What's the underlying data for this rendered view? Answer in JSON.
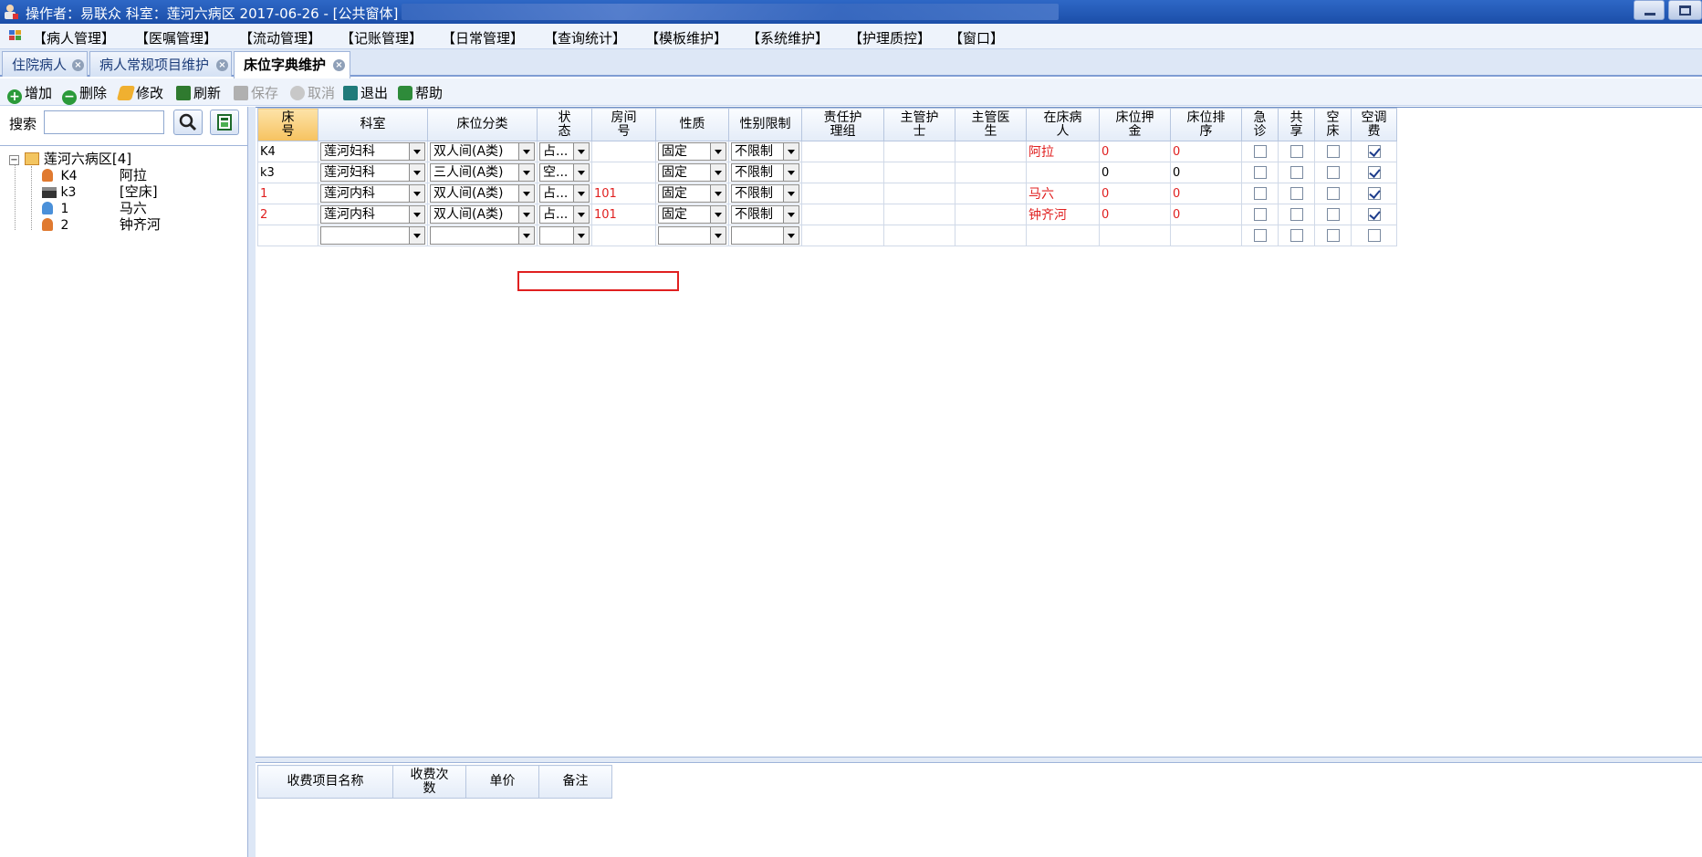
{
  "window": {
    "title": "操作者：易联众  科室：莲河六病区  2017-06-26 - [公共窗体]"
  },
  "menu": [
    "【病人管理】",
    "【医嘱管理】",
    "【流动管理】",
    "【记账管理】",
    "【日常管理】",
    "【查询统计】",
    "【模板维护】",
    "【系统维护】",
    "【护理质控】",
    "【窗口】"
  ],
  "tabs": [
    {
      "label": "住院病人"
    },
    {
      "label": "病人常规项目维护"
    },
    {
      "label": "床位字典维护"
    }
  ],
  "toolbar": {
    "add": "增加",
    "delete": "删除",
    "modify": "修改",
    "refresh": "刷新",
    "save": "保存",
    "cancel": "取消",
    "exit": "退出",
    "help": "帮助"
  },
  "search": {
    "label": "搜索",
    "value": ""
  },
  "tree": {
    "root": "莲河六病区[4]",
    "items": [
      {
        "bed": "K4",
        "patient": "阿拉"
      },
      {
        "bed": "k3",
        "patient": "[空床]"
      },
      {
        "bed": "1",
        "patient": "马六"
      },
      {
        "bed": "2",
        "patient": "钟齐河"
      }
    ]
  },
  "grid": {
    "headers": {
      "bed_no": "床\n号",
      "dept": "科室",
      "category": "床位分类",
      "status": "状\n态",
      "room": "房间\n号",
      "nature": "性质",
      "gender": "性别限制",
      "nurse_group": "责任护\n理组",
      "nurse": "主管护\n士",
      "doctor": "主管医\n生",
      "patient": "在床病\n人",
      "deposit": "床位押\n金",
      "order": "床位排\n序",
      "emergency": "急\n诊",
      "shared": "共\n享",
      "empty": "空\n床",
      "ac": "空调\n费"
    },
    "rows": [
      {
        "bed_no": "K4",
        "dept": "莲河妇科",
        "category": "双人间(A类)",
        "status": "占...",
        "room": "",
        "nature": "固定",
        "gender": "不限制",
        "patient": "阿拉",
        "deposit": "0",
        "order": "0",
        "emergency": false,
        "shared": false,
        "empty": false,
        "ac": true,
        "red": false
      },
      {
        "bed_no": "k3",
        "dept": "莲河妇科",
        "category": "三人间(A类)",
        "status": "空...",
        "room": "",
        "nature": "固定",
        "gender": "不限制",
        "patient": "",
        "deposit": "0",
        "order": "0",
        "emergency": false,
        "shared": false,
        "empty": false,
        "ac": true,
        "red": false
      },
      {
        "bed_no": "1",
        "dept": "莲河内科",
        "category": "双人间(A类)",
        "status": "占...",
        "room": "101",
        "nature": "固定",
        "gender": "不限制",
        "patient": "马六",
        "deposit": "0",
        "order": "0",
        "emergency": false,
        "shared": false,
        "empty": false,
        "ac": true,
        "red": true
      },
      {
        "bed_no": "2",
        "dept": "莲河内科",
        "category": "双人间(A类)",
        "status": "占...",
        "room": "101",
        "nature": "固定",
        "gender": "不限制",
        "patient": "钟齐河",
        "deposit": "0",
        "order": "0",
        "emergency": false,
        "shared": false,
        "empty": false,
        "ac": true,
        "red": true
      },
      {
        "bed_no": "",
        "dept": "",
        "category": "",
        "status": "",
        "room": "",
        "nature": "",
        "gender": "",
        "patient": "",
        "deposit": "",
        "order": "",
        "emergency": false,
        "shared": false,
        "empty": false,
        "ac": false,
        "red": false
      }
    ]
  },
  "fee_grid": {
    "headers": {
      "name": "收费项目名称",
      "times": "收费次\n数",
      "price": "单价",
      "remark": "备注"
    }
  },
  "colors": {
    "accent": "#1b4ea8",
    "highlight": "#e02020",
    "sorted_header": "#f6c260"
  }
}
